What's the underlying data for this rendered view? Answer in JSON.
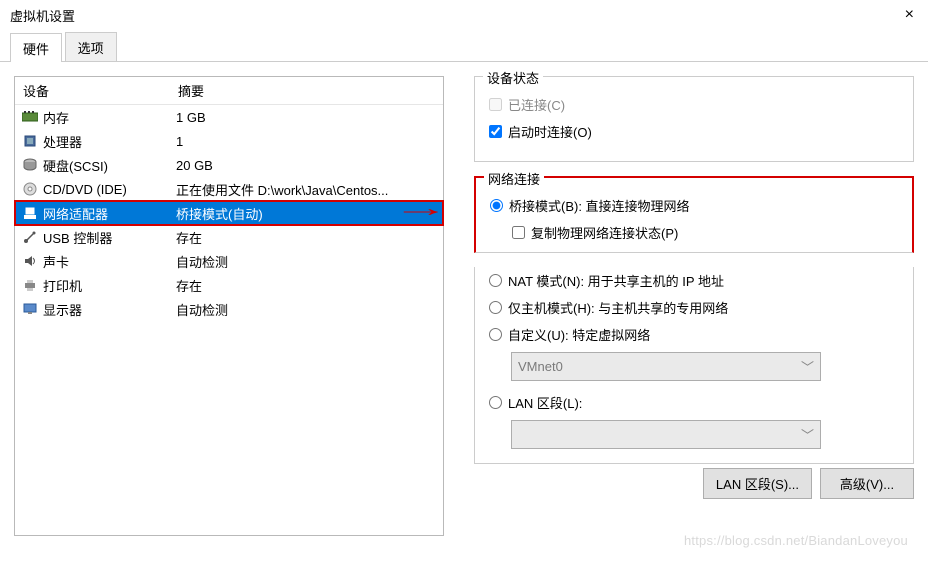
{
  "window": {
    "title": "虚拟机设置",
    "close": "×"
  },
  "tabs": {
    "hardware": "硬件",
    "options": "选项"
  },
  "list": {
    "head_device": "设备",
    "head_summary": "摘要",
    "rows": [
      {
        "name": "内存",
        "summary": "1 GB"
      },
      {
        "name": "处理器",
        "summary": "1"
      },
      {
        "name": "硬盘(SCSI)",
        "summary": "20 GB"
      },
      {
        "name": "CD/DVD (IDE)",
        "summary": "正在使用文件 D:\\work\\Java\\Centos..."
      },
      {
        "name": "网络适配器",
        "summary": "桥接模式(自动)"
      },
      {
        "name": "USB 控制器",
        "summary": "存在"
      },
      {
        "name": "声卡",
        "summary": "自动检测"
      },
      {
        "name": "打印机",
        "summary": "存在"
      },
      {
        "name": "显示器",
        "summary": "自动检测"
      }
    ]
  },
  "status": {
    "title": "设备状态",
    "connected": "已连接(C)",
    "connect_at_poweron": "启动时连接(O)"
  },
  "net": {
    "title": "网络连接",
    "bridged": "桥接模式(B): 直接连接物理网络",
    "replicate": "复制物理网络连接状态(P)",
    "nat": "NAT 模式(N): 用于共享主机的 IP 地址",
    "hostonly": "仅主机模式(H): 与主机共享的专用网络",
    "custom": "自定义(U): 特定虚拟网络",
    "custom_sel": "VMnet0",
    "lanseg": "LAN 区段(L):",
    "lanseg_sel": ""
  },
  "buttons": {
    "lanseg": "LAN 区段(S)...",
    "advanced": "高级(V)..."
  },
  "watermark": "https://blog.csdn.net/BiandanLoveyou"
}
